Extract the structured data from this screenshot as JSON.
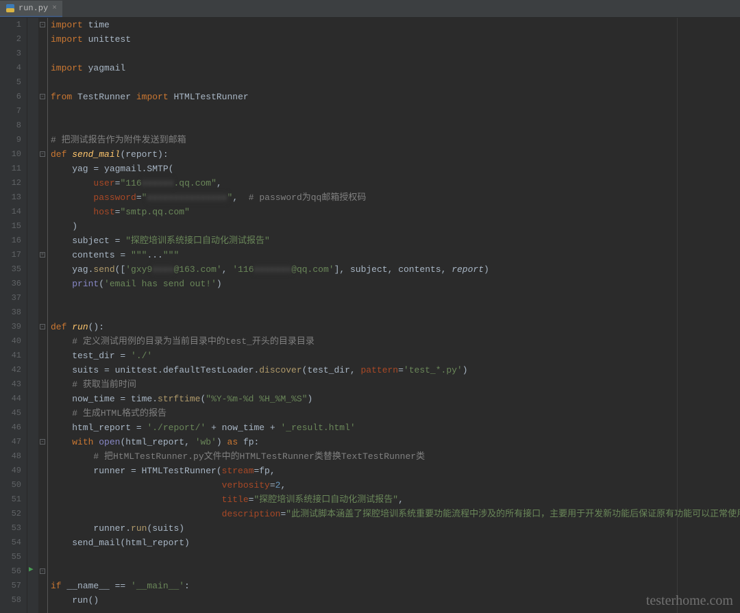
{
  "tab": {
    "filename": "run.py",
    "close_label": "×"
  },
  "watermark": "testerhome.com",
  "line_numbers": [
    1,
    2,
    3,
    4,
    5,
    6,
    7,
    8,
    9,
    10,
    11,
    12,
    13,
    14,
    15,
    16,
    17,
    35,
    36,
    37,
    38,
    39,
    40,
    41,
    42,
    43,
    44,
    45,
    46,
    47,
    48,
    49,
    50,
    51,
    52,
    53,
    54,
    55,
    56,
    57,
    58
  ],
  "code": {
    "l1": "import time",
    "l2": "import unittest",
    "l4": "import yagmail",
    "l6": "from TestRunner import HTMLTestRunner",
    "l9_cmt": "# 把测试报告作为附件发送到邮箱",
    "l10_def": "def send_mail(report):",
    "l11": "    yag = yagmail.SMTP(",
    "l12_user": "        user=\"116",
    "l12_censor": "xxxxxx",
    "l12_tail": ".qq.com\",",
    "l13_pw": "        password=\"",
    "l13_censor": "xxxxxxxxxxxxxxx",
    "l13_tail": "\",  # password为qq邮箱授权码",
    "l14": "        host=\"smtp.qq.com\"",
    "l15": "    )",
    "l16_subj": "    subject = \"探腔培训系统接口自动化测试报告\"",
    "l17": "    contents = \"\"\"...\"\"\"",
    "l35_a": "    yag.send(['gxy9",
    "l35_c1": "xxxx",
    "l35_b": "@163.com', '116",
    "l35_c2": "xxxxxxx",
    "l35_c": "@qq.com'], subject, contents, report)",
    "l36": "    print('email has send out!')",
    "l39": "def run():",
    "l40_cmt": "    # 定义测试用例的目录为当前目录中的test_开头的目录目录",
    "l41": "    test_dir = './'",
    "l42": "    suits = unittest.defaultTestLoader.discover(test_dir, pattern='test_*.py')",
    "l43_cmt": "    # 获取当前时间",
    "l44": "    now_time = time.strftime(\"%Y-%m-%d %H_%M_%S\")",
    "l45_cmt": "    # 生成HTML格式的报告",
    "l46": "    html_report = './report/' + now_time + '_result.html'",
    "l47": "    with open(html_report, 'wb') as fp:",
    "l48_cmt": "        # 把HtMLTestRunner.py文件中的HTMLTestRunner类替换TextTestRunner类",
    "l49": "        runner = HTMLTestRunner(stream=fp,",
    "l50": "                                verbosity=2,",
    "l51": "                                title=\"探腔培训系统接口自动化测试报告\",",
    "l52": "                                description=\"此测试脚本涵盖了探腔培训系统重要功能流程中涉及的所有接口，主要用于开发新功能后保证原有功能可以正常使用。\")",
    "l53": "        runner.run(suits)",
    "l54": "    send_mail(html_report)",
    "l57": "if __name__ == '__main__':",
    "l58": "    run()"
  }
}
